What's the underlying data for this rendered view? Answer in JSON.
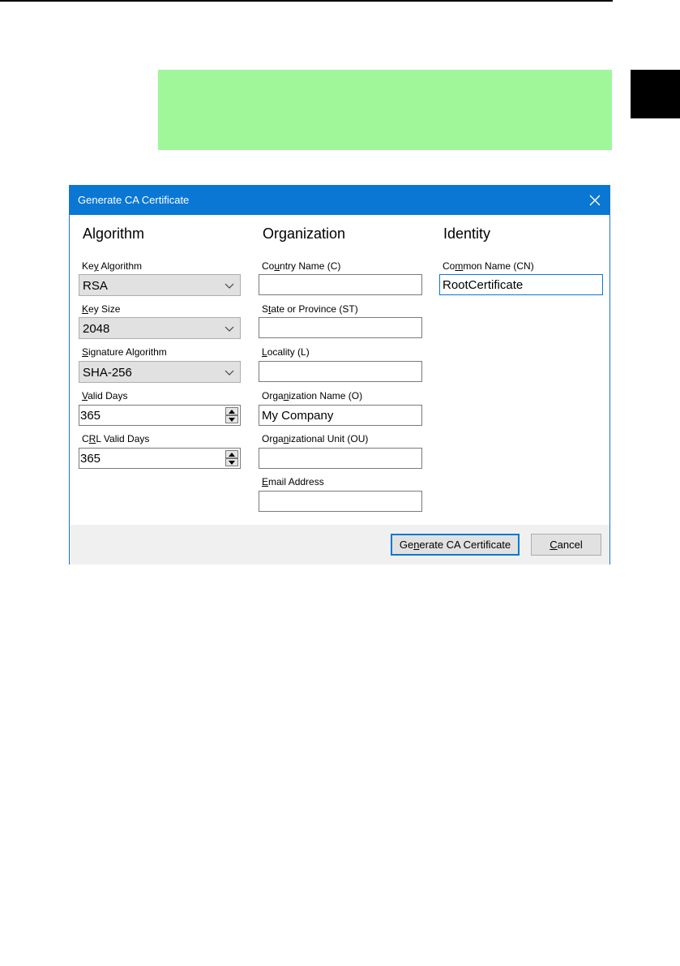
{
  "dialog": {
    "title": "Generate CA Certificate"
  },
  "sections": {
    "algorithm": "Algorithm",
    "organization": "Organization",
    "identity": "Identity"
  },
  "algorithm": {
    "key_algorithm": {
      "label_pre": "Ke",
      "label_u": "y",
      "label_post": " Algorithm",
      "value": "RSA"
    },
    "key_size": {
      "label_pre": "",
      "label_u": "K",
      "label_post": "ey Size",
      "value": "2048"
    },
    "signature_algorithm": {
      "label_pre": "",
      "label_u": "S",
      "label_post": "ignature Algorithm",
      "value": "SHA-256"
    },
    "valid_days": {
      "label_pre": "",
      "label_u": "V",
      "label_post": "alid Days",
      "value": "365"
    },
    "crl_valid_days": {
      "label_pre": "C",
      "label_u": "R",
      "label_post": "L Valid Days",
      "value": "365"
    }
  },
  "organization": {
    "country": {
      "label_pre": "Co",
      "label_u": "u",
      "label_post": "ntry Name (C)",
      "value": ""
    },
    "state": {
      "label_pre": "S",
      "label_u": "t",
      "label_post": "ate or Province (ST)",
      "value": ""
    },
    "locality": {
      "label_pre": "",
      "label_u": "L",
      "label_post": "ocality (L)",
      "value": ""
    },
    "org_name": {
      "label_pre": "Orga",
      "label_u": "n",
      "label_post": "ization Name (O)",
      "value": "My Company"
    },
    "org_unit": {
      "label_pre": "Orga",
      "label_u": "n",
      "label_post": "izational Unit (OU)",
      "value": ""
    },
    "email": {
      "label_pre": "",
      "label_u": "E",
      "label_post": "mail Address",
      "value": ""
    }
  },
  "identity": {
    "common_name": {
      "label_pre": "Co",
      "label_u": "m",
      "label_post": "mon Name (CN)",
      "value": "RootCertificate"
    }
  },
  "buttons": {
    "generate": {
      "pre": "Ge",
      "u": "n",
      "post": "erate CA Certificate"
    },
    "cancel": {
      "pre": "",
      "u": "C",
      "post": "ancel"
    }
  },
  "colors": {
    "title_bar": "#0a77d4",
    "highlight_box": "#9ff79a",
    "footer": "#f0f0f0"
  }
}
